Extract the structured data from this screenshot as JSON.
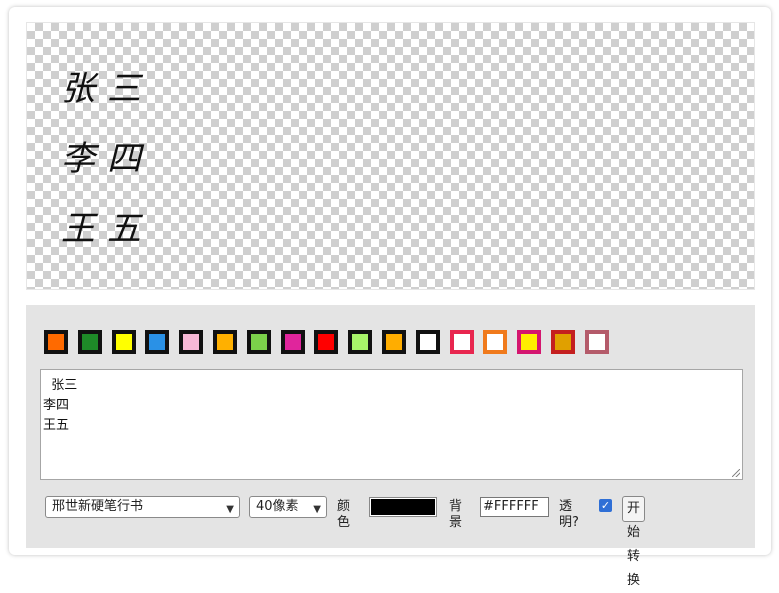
{
  "canvas": {
    "lines": [
      "张三",
      "李四",
      "王五"
    ]
  },
  "palette": {
    "swatches": [
      {
        "fill": "#ff6a00",
        "border": "#111111"
      },
      {
        "fill": "#1e8a28",
        "border": "#111111"
      },
      {
        "fill": "#ffff00",
        "border": "#111111"
      },
      {
        "fill": "#2a91e6",
        "border": "#111111"
      },
      {
        "fill": "#f7b8d6",
        "border": "#111111"
      },
      {
        "fill": "#ffb000",
        "border": "#111111"
      },
      {
        "fill": "#7bd14a",
        "border": "#111111"
      },
      {
        "fill": "#e0259c",
        "border": "#111111"
      },
      {
        "fill": "#ff0000",
        "border": "#111111"
      },
      {
        "fill": "#a8f36a",
        "border": "#111111"
      },
      {
        "fill": "#ffad00",
        "border": "#111111"
      },
      {
        "fill": "#ffffff",
        "border": "#111111"
      },
      {
        "fill": "#ffffff",
        "border": "#e8264f"
      },
      {
        "fill": "#ffffff",
        "border": "#f07a1c"
      },
      {
        "fill": "#ffee00",
        "border": "#d4166f"
      },
      {
        "fill": "#e0a000",
        "border": "#c41f1f"
      },
      {
        "fill": "#ffffff",
        "border": "#b45b6a"
      }
    ]
  },
  "input": {
    "text": "  张三\n李四\n王五"
  },
  "controls": {
    "font_select": "邢世新硬笔行书",
    "size_select": "40像素",
    "color_label": "颜色",
    "color_value": "#000000",
    "bg_label": "背景",
    "bg_value": "#FFFFFF",
    "transparent_label": "透明?",
    "transparent_checked": true,
    "convert_button": "开始转换"
  }
}
